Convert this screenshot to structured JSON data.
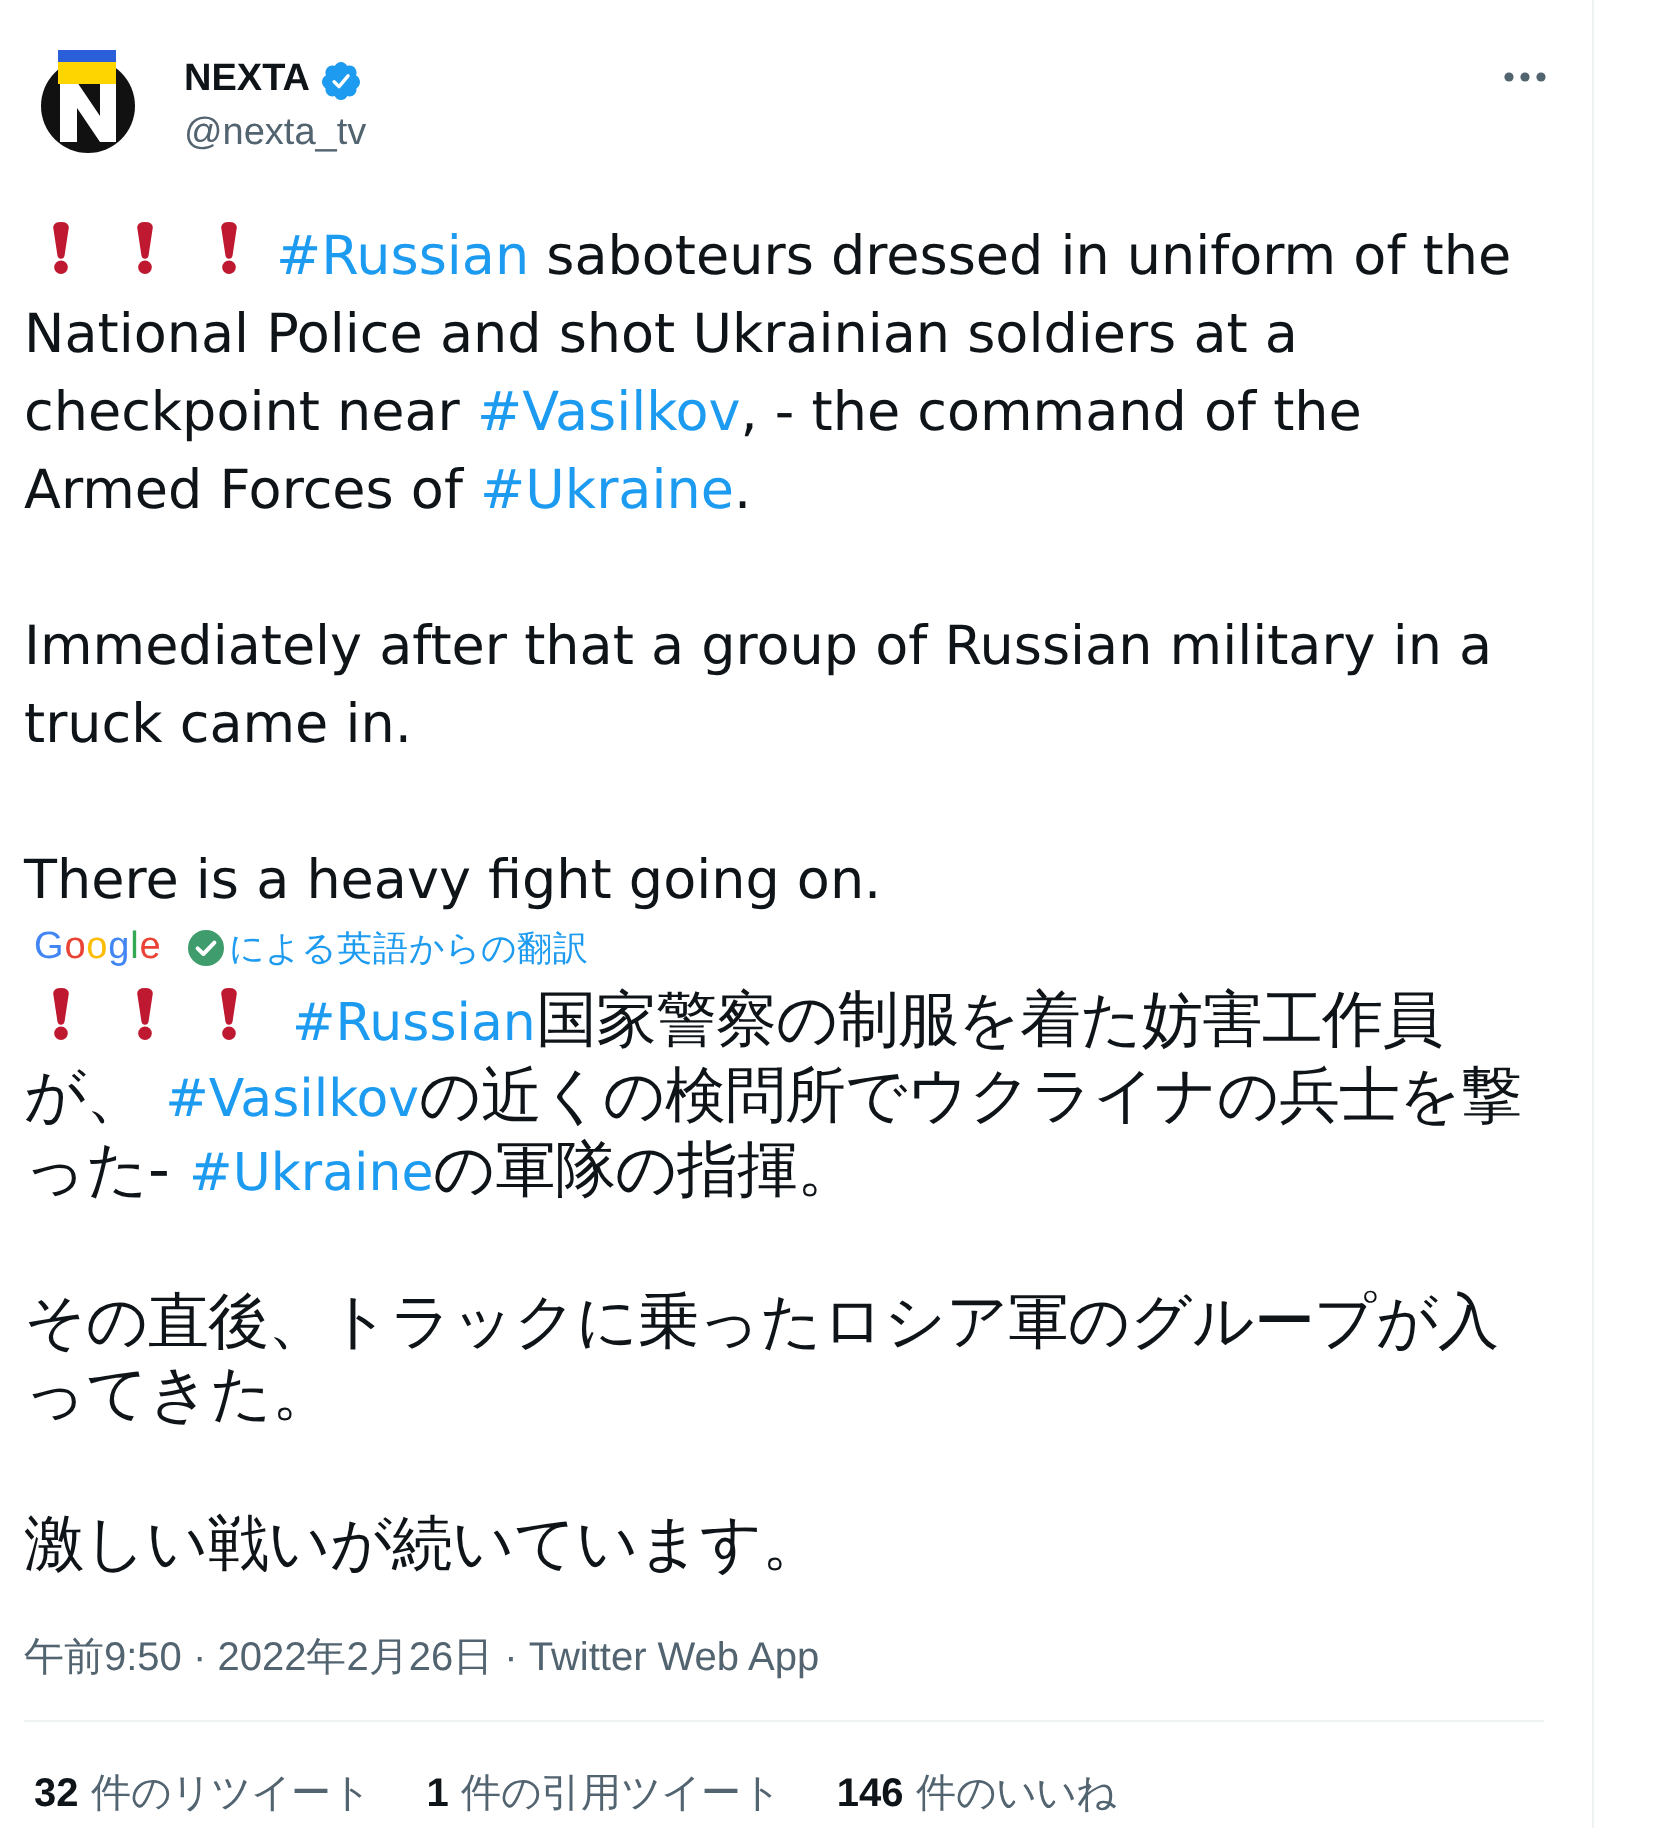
{
  "author": {
    "name": "NEXTA",
    "verified": true,
    "handle": "@nexta_tv"
  },
  "tweet": {
    "paragraphs": [
      [
        {
          "kind": "emoji"
        },
        {
          "kind": "emoji"
        },
        {
          "kind": "emoji"
        },
        {
          "kind": "hashtag",
          "text": "#Russian"
        },
        {
          "kind": "text",
          "text": " saboteurs dressed in uniform of the National Police and shot Ukrainian soldiers at a checkpoint near "
        },
        {
          "kind": "hashtag",
          "text": "#Vasilkov"
        },
        {
          "kind": "text",
          "text": ", - the command of the Armed Forces of "
        },
        {
          "kind": "hashtag",
          "text": "#Ukraine"
        },
        {
          "kind": "text",
          "text": "."
        }
      ],
      [
        {
          "kind": "text",
          "text": "Immediately after that a group of Russian military in a truck came in."
        }
      ],
      [
        {
          "kind": "text",
          "text": "There is a heavy fight going on."
        }
      ]
    ]
  },
  "translation": {
    "provider": "Google",
    "note": "による英語からの翻訳",
    "paragraphs": [
      [
        {
          "kind": "emoji"
        },
        {
          "kind": "emoji"
        },
        {
          "kind": "emoji"
        },
        {
          "kind": "hashtag",
          "text": "#Russian"
        },
        {
          "kind": "text",
          "text": "国家警察の制服を着た妨害工作員が、 "
        },
        {
          "kind": "hashtag",
          "text": "#Vasilkov"
        },
        {
          "kind": "text",
          "text": "の近くの検問所でウクライナの兵士を撃った- "
        },
        {
          "kind": "hashtag",
          "text": "#Ukraine"
        },
        {
          "kind": "text",
          "text": "の軍隊の指揮。"
        }
      ],
      [
        {
          "kind": "text",
          "text": "その直後、トラックに乗ったロシア軍のグループが入ってきた。"
        }
      ],
      [
        {
          "kind": "text",
          "text": "激しい戦いが続いています。"
        }
      ]
    ]
  },
  "timestamp": "午前9:50 · 2022年2月26日 · Twitter Web App",
  "stats": [
    {
      "count": "32",
      "label": "件のリツイート"
    },
    {
      "count": "1",
      "label": "件の引用ツイート"
    },
    {
      "count": "146",
      "label": "件のいいね"
    }
  ]
}
